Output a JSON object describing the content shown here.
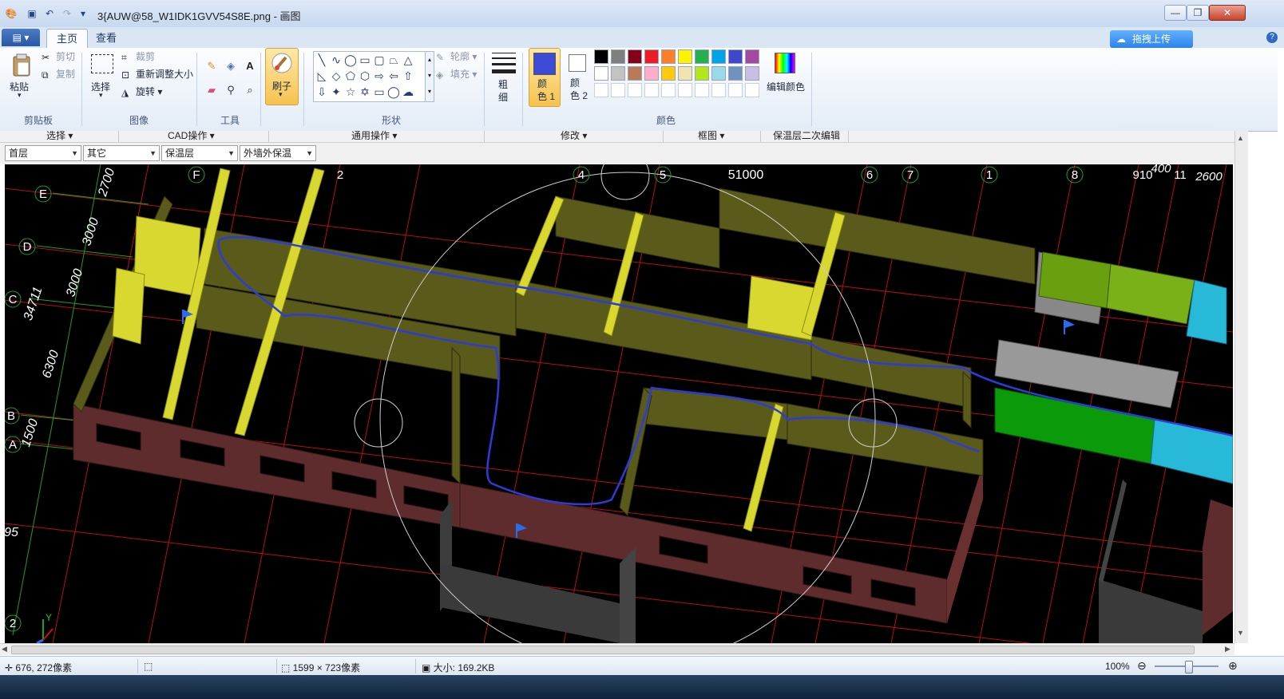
{
  "window": {
    "title": "3{AUW@58_W1IDK1GVV54S8E.png - 画图",
    "controls": [
      "minimize",
      "maximize",
      "close"
    ]
  },
  "tabs": {
    "file": "▤ ▾",
    "home": "主页",
    "view": "查看"
  },
  "upload": {
    "label": "拖拽上传"
  },
  "ribbon": {
    "clipboard": {
      "paste": "粘贴",
      "cut": "剪切",
      "copy": "复制",
      "group": "剪贴板"
    },
    "image": {
      "select": "选择",
      "crop": "裁剪",
      "resize": "重新调整大小",
      "rotate": "旋转 ▾",
      "group": "图像"
    },
    "tools": {
      "group": "工具"
    },
    "brush": {
      "label": "刷子"
    },
    "shapes": {
      "outline": "轮廓 ▾",
      "fill": "填充 ▾",
      "group": "形状"
    },
    "size": {
      "label": "粗\n细"
    },
    "color1": {
      "label": "颜\n色 1",
      "value": "#3d4bd6"
    },
    "color2": {
      "label": "颜\n色 2",
      "value": "#ffffff"
    },
    "edit_colors": "编辑颜色",
    "colors_group": "颜色",
    "palette_row1": [
      "#000000",
      "#7f7f7f",
      "#880015",
      "#ed1c24",
      "#ff7f27",
      "#fff200",
      "#22b14c",
      "#00a2e8",
      "#3f48cc",
      "#a349a4"
    ],
    "palette_row2": [
      "#ffffff",
      "#c3c3c3",
      "#b97a57",
      "#ffaec9",
      "#ffc90e",
      "#efe4b0",
      "#b5e61d",
      "#99d9ea",
      "#7092be",
      "#c8bfe7"
    ]
  },
  "cad_menu": [
    "选择 ▾",
    "CAD操作 ▾",
    "通用操作 ▾",
    "修改 ▾",
    "框图 ▾",
    "保温层二次编辑"
  ],
  "dropdowns": [
    "首层",
    "其它",
    "保温层",
    "外墙外保温"
  ],
  "canvas": {
    "axis_top": [
      "F",
      "2",
      "4",
      "5",
      "51000",
      "6",
      "7",
      "1",
      "8",
      "910",
      "11",
      "2600",
      "400"
    ],
    "axis_left": [
      "E",
      "D",
      "C",
      "B",
      "A",
      "2"
    ],
    "dims_left": [
      "2700",
      "3000",
      "3000",
      "34711",
      "6300",
      "1500",
      "95"
    ],
    "ucs_y": "Y"
  },
  "status": {
    "cursor": "676, 272像素",
    "canvas_size": "1599 × 723像素",
    "file_size": "大小: 169.2KB",
    "zoom": "100%"
  }
}
